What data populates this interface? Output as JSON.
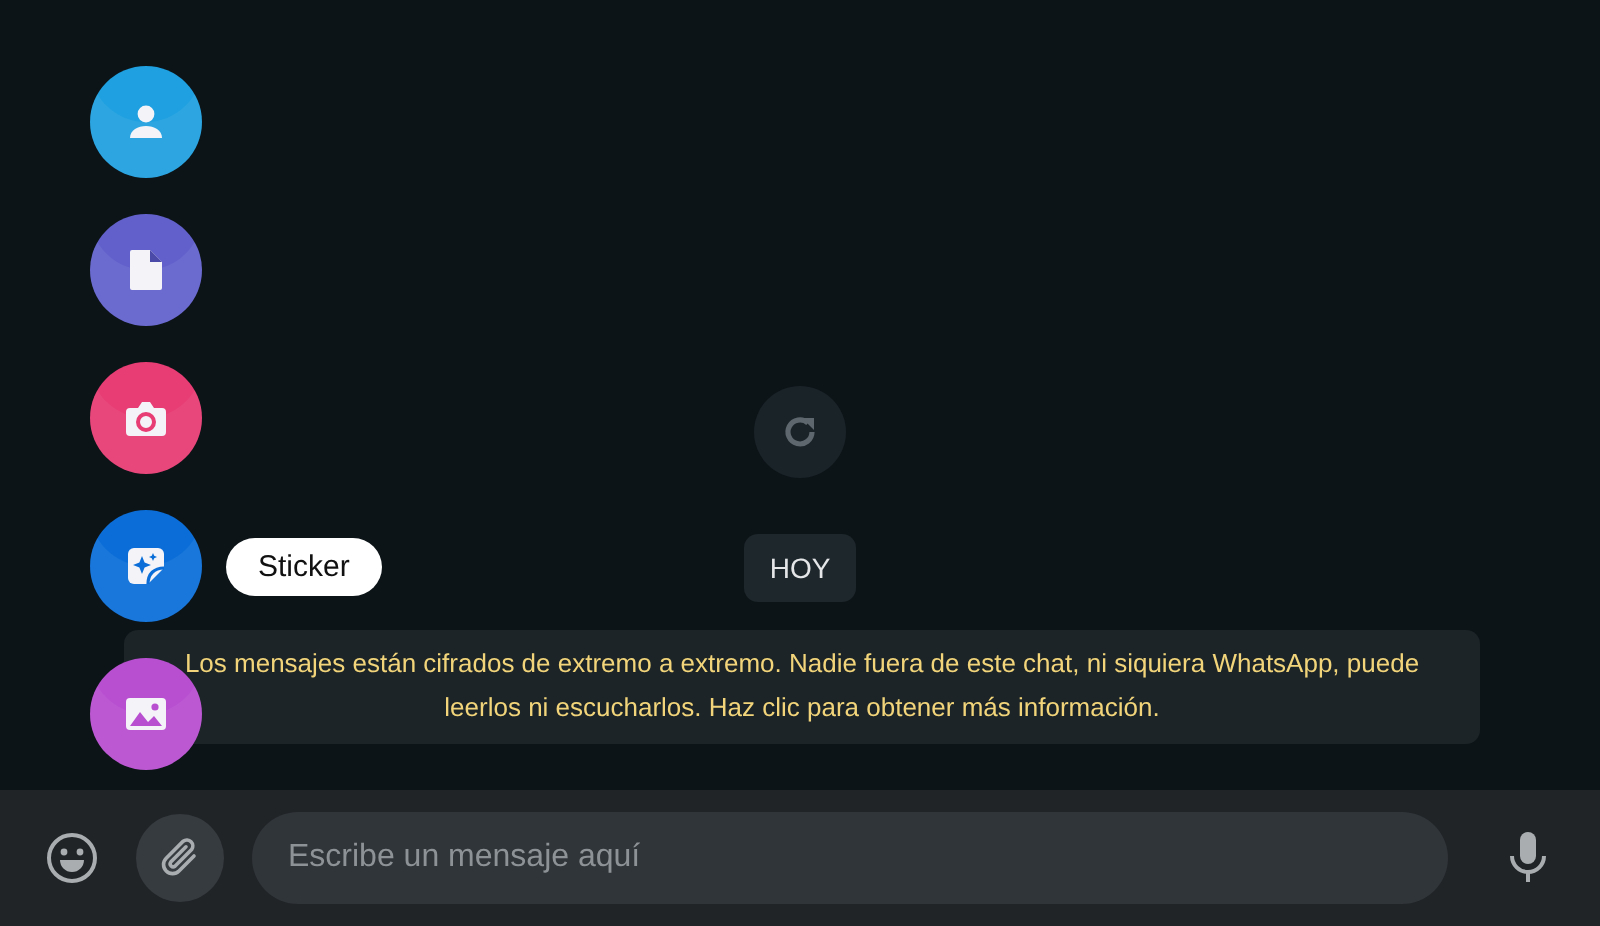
{
  "chat": {
    "date_chip": "HOY",
    "encryption_notice": "Los mensajes están cifrados de extremo a extremo. Nadie fuera de este chat, ni siquiera WhatsApp, puede leerlos ni escucharlos. Haz clic para obtener más información."
  },
  "attach_menu": [
    {
      "kind": "contact",
      "color": "#1fa0e0"
    },
    {
      "kind": "document",
      "color": "#6261cc"
    },
    {
      "kind": "camera",
      "color": "#e73c74"
    },
    {
      "kind": "sticker",
      "color": "#0b6ed8",
      "tooltip": "Sticker"
    },
    {
      "kind": "photos",
      "color": "#b84fd0"
    }
  ],
  "composer": {
    "placeholder": "Escribe un mensaje aquí"
  }
}
